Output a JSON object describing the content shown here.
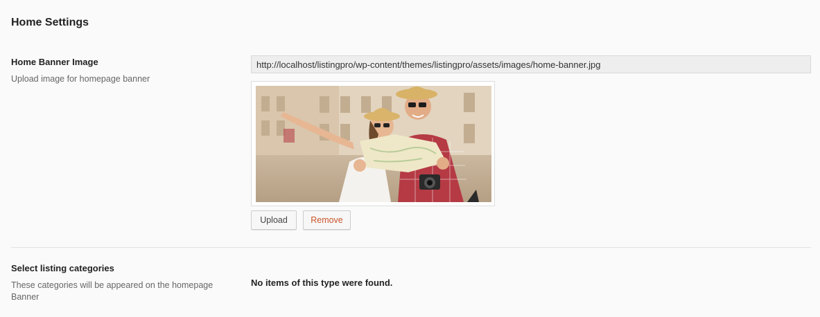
{
  "section": {
    "title": "Home Settings"
  },
  "banner": {
    "label": "Home Banner Image",
    "description": "Upload image for homepage banner",
    "url_value": "http://localhost/listingpro/wp-content/themes/listingpro/assets/images/home-banner.jpg",
    "image_alt": "home-banner",
    "upload_label": "Upload",
    "remove_label": "Remove"
  },
  "categories": {
    "label": "Select listing categories",
    "description": "These categories will be appeared on the homepage Banner",
    "empty_message": "No items of this type were found."
  },
  "colors": {
    "remove_text": "#c9552b",
    "input_bg": "#eeeeee",
    "page_bg": "#fafafa"
  }
}
